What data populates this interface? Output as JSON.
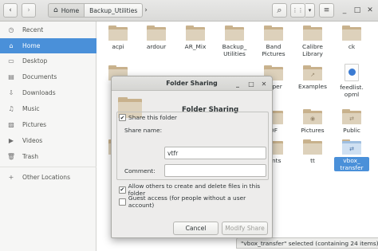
{
  "header": {
    "back_icon": "‹",
    "forward_icon": "›",
    "home_icon": "⌂",
    "breadcrumbs": [
      "Home",
      "Backup_Utilities"
    ],
    "more_icon": "›",
    "search_icon": "⌕",
    "view_icon": "⋮⋮",
    "menu_icon": "▾"
  },
  "sidebar": {
    "items": [
      {
        "label": "Recent",
        "icon": "◷"
      },
      {
        "label": "Home",
        "icon": "⌂"
      },
      {
        "label": "Desktop",
        "icon": "▭"
      },
      {
        "label": "Documents",
        "icon": "▤"
      },
      {
        "label": "Downloads",
        "icon": "⇩"
      },
      {
        "label": "Music",
        "icon": "♫"
      },
      {
        "label": "Pictures",
        "icon": "▨"
      },
      {
        "label": "Videos",
        "icon": "▶"
      },
      {
        "label": "Trash",
        "icon": "🗑"
      },
      {
        "label": "Other Locations",
        "icon": "+"
      }
    ]
  },
  "files": [
    {
      "label": "acpi"
    },
    {
      "label": "ardour"
    },
    {
      "label": "AR_Mix"
    },
    {
      "label": "Backup_\nUtilities"
    },
    {
      "label": "Band\nPictures"
    },
    {
      "label": "Calibre\nLibrary"
    },
    {
      "label": "ck"
    },
    {
      "label": "D"
    },
    {
      "label": "paper"
    },
    {
      "label": "Examples"
    },
    {
      "label": "feedlist.\nopml"
    },
    {
      "label": "DF"
    },
    {
      "label": "Pictures"
    },
    {
      "label": "Public"
    },
    {
      "label": "Rin"
    },
    {
      "label": "rents"
    },
    {
      "label": "tt"
    },
    {
      "label": "vbox_\ntransfer"
    }
  ],
  "dialog": {
    "title": "Folder Sharing",
    "heading": "Folder Sharing",
    "share_folder_label": "Share this folder",
    "share_name_label": "Share name:",
    "share_name_value": "vtfr",
    "comment_label": "Comment:",
    "comment_value": "",
    "allow_others_label": "Allow others to create and delete files in this folder",
    "guest_access_label": "Guest access (for people without a user account)",
    "cancel_label": "Cancel",
    "modify_label": "Modify Share",
    "minimize_icon": "_",
    "maximize_icon": "□",
    "close_icon": "✕",
    "check_mark": "✔"
  },
  "status": {
    "text": "\"vbox_transfer\" selected  (containing 24 items)"
  }
}
